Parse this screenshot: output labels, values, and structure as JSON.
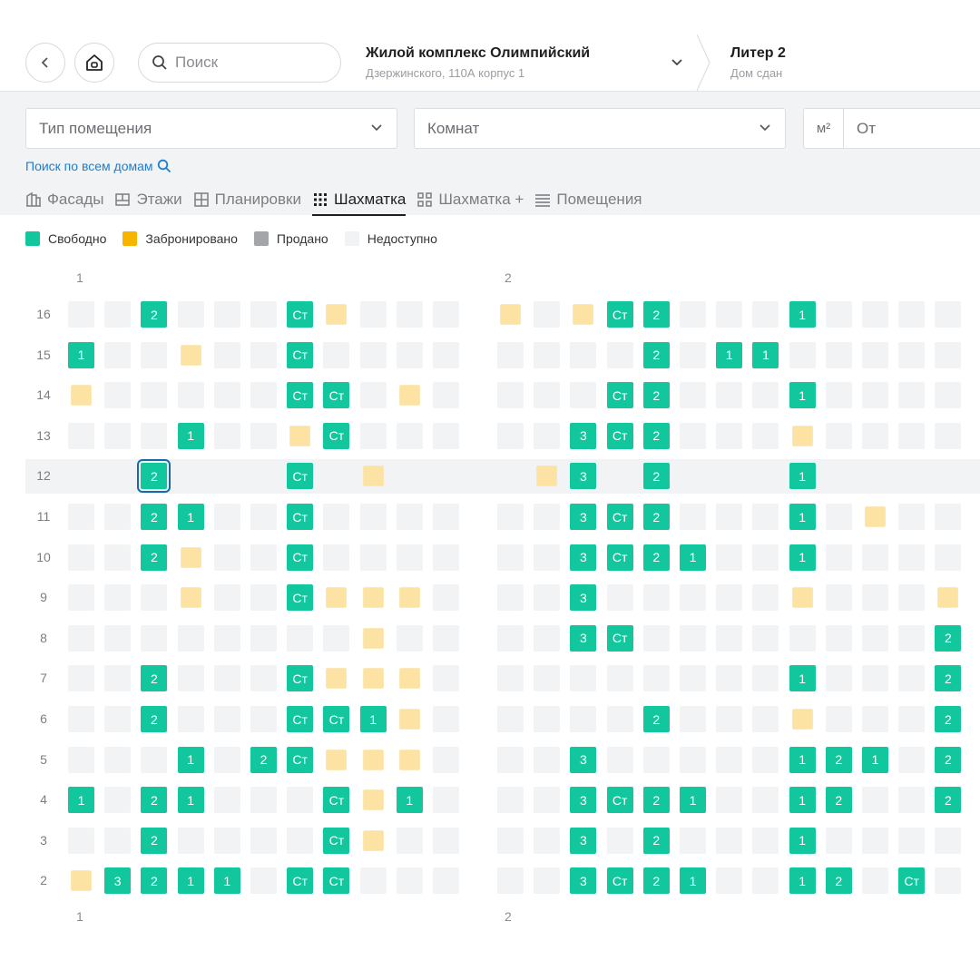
{
  "header": {
    "search_placeholder": "Поиск",
    "complex_title": "Жилой комплекс Олимпийский",
    "complex_address": "Дзержинского, 110А корпус 1",
    "liter_title": "Литер 2",
    "liter_status": "Дом сдан"
  },
  "filters": {
    "type_label": "Тип помещения",
    "rooms_label": "Комнат",
    "area_unit": "м²",
    "area_from": "От",
    "search_all": "Поиск по всем домам"
  },
  "tabs": [
    {
      "label": "Фасады",
      "icon": "facade-icon"
    },
    {
      "label": "Этажи",
      "icon": "floors-icon"
    },
    {
      "label": "Планировки",
      "icon": "layout-icon"
    },
    {
      "label": "Шахматка",
      "icon": "dots-grid-icon"
    },
    {
      "label": "Шахматка +",
      "icon": "grid-plus-icon"
    },
    {
      "label": "Помещения",
      "icon": "list-icon"
    }
  ],
  "active_tab": 3,
  "legend": [
    {
      "label": "Свободно",
      "color": "#12c79e"
    },
    {
      "label": "Забронировано",
      "color": "#f7b500"
    },
    {
      "label": "Продано",
      "color": "#a3a5a8"
    },
    {
      "label": "Недоступно",
      "color": "#f2f3f4"
    }
  ],
  "sections": [
    "1",
    "2"
  ],
  "floors": [
    {
      "floor": "16",
      "s1": "__2___C*___",
      "s2": "*_*C2___1____"
    },
    {
      "floor": "15",
      "s1": "1__*__C____",
      "s2": "____2_11_____"
    },
    {
      "floor": "14",
      "s1": "*_____CC_*_",
      "s2": "___C2___1____"
    },
    {
      "floor": "13",
      "s1": "___1__*C___",
      "s2": "__3C2___*____"
    },
    {
      "floor": "12",
      "s1": "..2...C.*..",
      "s2": ".*3.2...1...."
    },
    {
      "floor": "11",
      "s1": "__21__C____",
      "s2": "__3C2___1_*__"
    },
    {
      "floor": "10",
      "s1": "__2*__C____",
      "s2": "__3C21__1____"
    },
    {
      "floor": "9",
      "s1": "___*__C***_",
      "s2": "__3_____*___*"
    },
    {
      "floor": "8",
      "s1": "________*__",
      "s2": "__3C________2"
    },
    {
      "floor": "7",
      "s1": "__2___C***_",
      "s2": "________1___2"
    },
    {
      "floor": "6",
      "s1": "__2___CC1*_",
      "s2": "____2___*___2"
    },
    {
      "floor": "5",
      "s1": "___1_2C***_",
      "s2": "__3_____121_2"
    },
    {
      "floor": "4",
      "s1": "1_21___C*1_",
      "s2": "__3C21__12__2"
    },
    {
      "floor": "3",
      "s1": "__2____C*__",
      "s2": "__3_2___1____"
    },
    {
      "floor": "2",
      "s1": "*3211_CC___",
      "s2": "__3C21__12_C_"
    }
  ],
  "selected": {
    "floor": "12",
    "section": "1",
    "index": 2
  },
  "cell_labels": {
    "C": "Ст",
    "1": "1",
    "2": "2",
    "3": "3"
  }
}
